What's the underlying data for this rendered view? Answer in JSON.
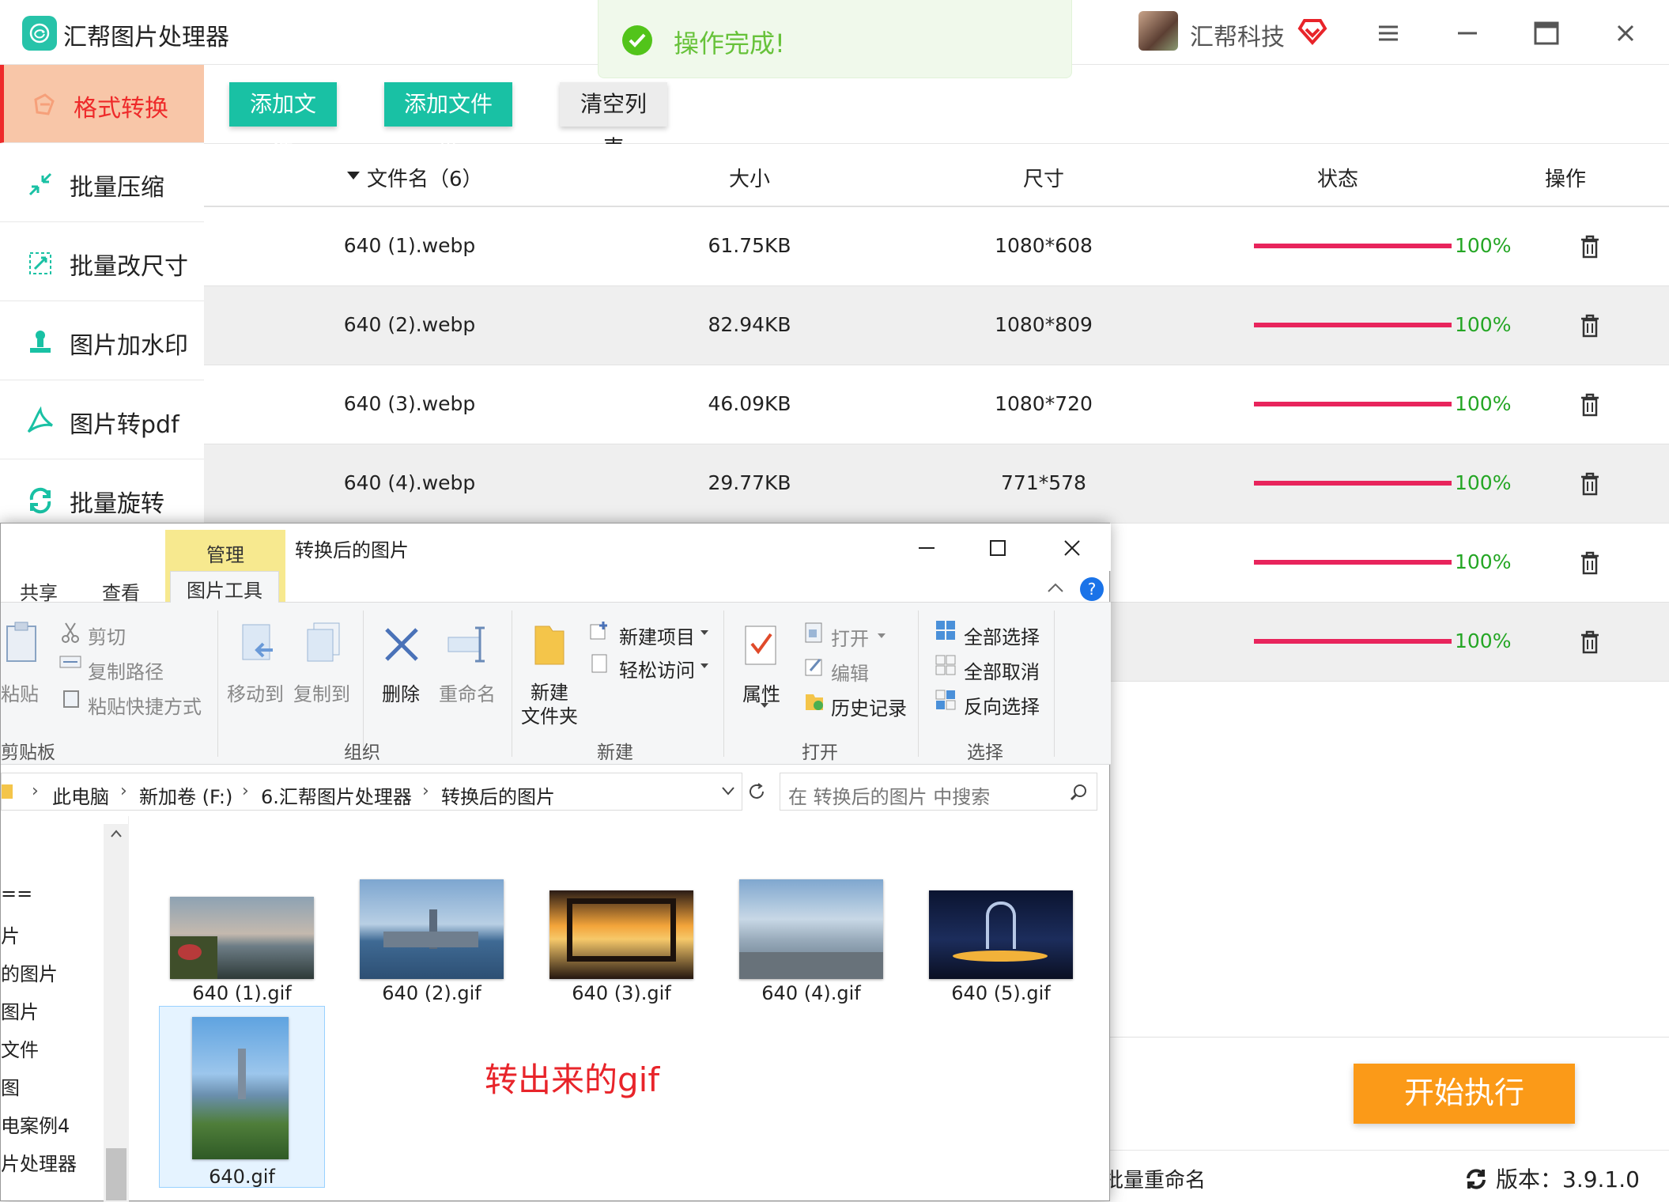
{
  "app": {
    "title": "汇帮图片处理器",
    "user_name": "汇帮科技",
    "toast": "操作完成!",
    "accent": "#19c1a4",
    "danger": "#ee2a2a"
  },
  "sidebar": {
    "items": [
      {
        "label": "格式转换",
        "icon": "format-convert-icon"
      },
      {
        "label": "批量压缩",
        "icon": "compress-icon"
      },
      {
        "label": "批量改尺寸",
        "icon": "resize-icon"
      },
      {
        "label": "图片加水印",
        "icon": "watermark-icon"
      },
      {
        "label": "图片转pdf",
        "icon": "pdf-icon"
      },
      {
        "label": "批量旋转",
        "icon": "rotate-icon"
      }
    ]
  },
  "toolbar": {
    "add_file": "添加文件",
    "add_folder": "添加文件夹",
    "clear_list": "清空列表"
  },
  "table": {
    "headers": {
      "name": "文件名（6）",
      "size": "大小",
      "dimension": "尺寸",
      "status": "状态",
      "action": "操作"
    },
    "rows": [
      {
        "name": "640 (1).webp",
        "size": "61.75KB",
        "dimension": "1080*608",
        "progress": "100%",
        "progress_value": 1.0
      },
      {
        "name": "640 (2).webp",
        "size": "82.94KB",
        "dimension": "1080*809",
        "progress": "100%",
        "progress_value": 1.0
      },
      {
        "name": "640 (3).webp",
        "size": "46.09KB",
        "dimension": "1080*720",
        "progress": "100%",
        "progress_value": 1.0
      },
      {
        "name": "640 (4).webp",
        "size": "29.77KB",
        "dimension": "771*578",
        "progress": "100%",
        "progress_value": 1.0
      },
      {
        "name": "",
        "size": "",
        "dimension": "",
        "progress": "100%",
        "progress_value": 1.0
      },
      {
        "name": "",
        "size": "",
        "dimension": "",
        "progress": "100%",
        "progress_value": 1.0
      }
    ]
  },
  "bottom": {
    "start": "开始执行",
    "rename": "批量重命名",
    "version": "版本：3.9.1.0"
  },
  "explorer": {
    "title": "转换后的图片",
    "context_tab": "管理",
    "tabs": [
      "共享",
      "查看",
      "图片工具"
    ],
    "ribbon": {
      "paste": "粘贴",
      "cut": "剪切",
      "copy_path": "复制路径",
      "paste_shortcut": "粘贴快捷方式",
      "clipboard": "剪贴板",
      "move_to": "移动到",
      "copy_to": "复制到",
      "delete": "删除",
      "rename": "重命名",
      "organize": "组织",
      "new_folder_1": "新建",
      "new_folder_2": "文件夹",
      "new_item": "新建项目",
      "easy_access": "轻松访问",
      "new": "新建",
      "properties": "属性",
      "open_btn": "打开",
      "edit": "编辑",
      "history": "历史记录",
      "open": "打开",
      "select_all": "全部选择",
      "select_none": "全部取消",
      "invert": "反向选择",
      "select": "选择"
    },
    "breadcrumb": [
      "此电脑",
      "新加卷 (F:)",
      "6.汇帮图片处理器",
      "转换后的图片"
    ],
    "search_placeholder": "在 转换后的图片 中搜索",
    "nav": [
      "==",
      "片",
      "的图片",
      "图片",
      "文件",
      "图",
      "电案例4",
      "片处理器"
    ],
    "files": [
      "640 (1).gif",
      "640 (2).gif",
      "640 (3).gif",
      "640 (4).gif",
      "640 (5).gif",
      "640.gif"
    ],
    "annotation": "转出来的gif"
  }
}
